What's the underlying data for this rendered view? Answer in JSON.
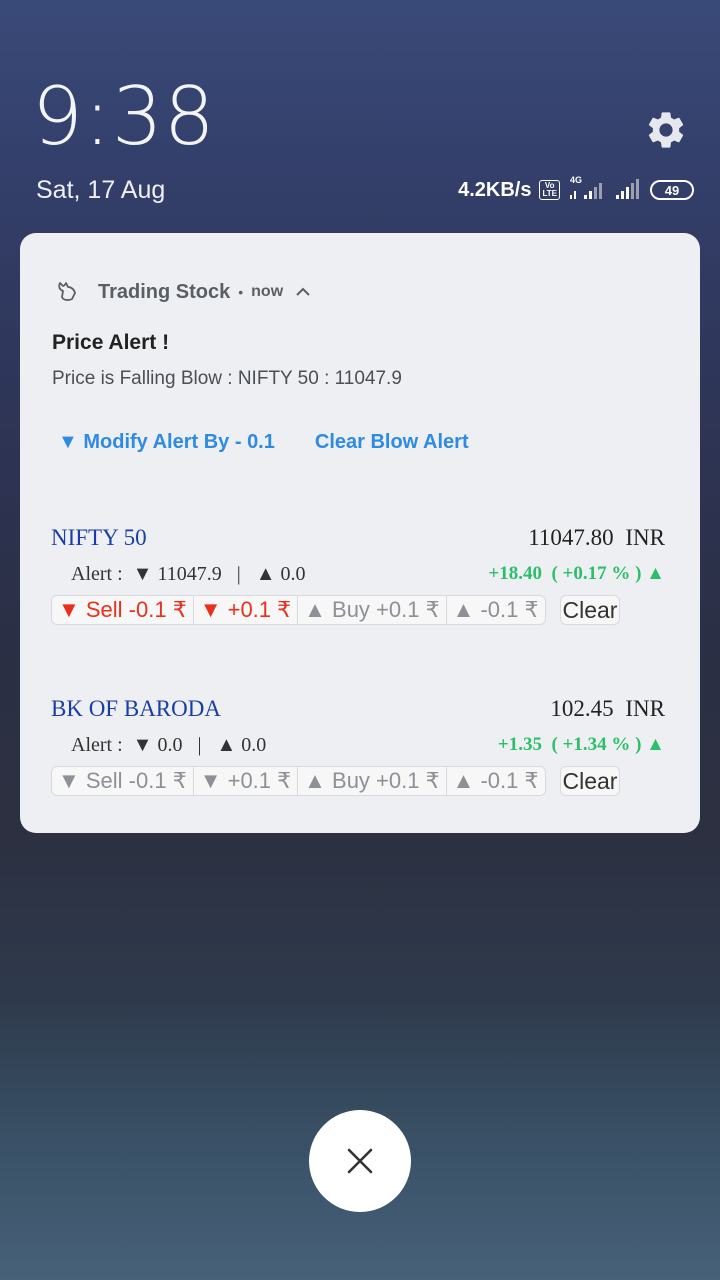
{
  "lockscreen": {
    "time": "9:38",
    "date": "Sat, 17 Aug"
  },
  "status": {
    "net_speed": "4.2KB/s",
    "volte_top": "Vo",
    "volte_bottom": "LTE",
    "network": "4G",
    "battery": "49"
  },
  "notification": {
    "app_name": "Trading Stock",
    "separator": "•",
    "when": "now",
    "title": "Price Alert !",
    "text": "Price is Falling Blow : NIFTY 50 : 11047.9",
    "actions": [
      "▼ Modify Alert By - 0.1",
      "Clear Blow Alert"
    ]
  },
  "stocks": [
    {
      "name": "NIFTY 50",
      "price": "11047.80 INR",
      "alert": "Alert :  ▼ 11047.9   |   ▲ 0.0",
      "change": "+18.40  ( +0.17 % ) ▲",
      "buttons": [
        "▼ Sell -0.1 ₹",
        "▼ +0.1 ₹",
        "▲ Buy +0.1 ₹",
        "▲ -0.1 ₹"
      ],
      "clear": "Clear"
    },
    {
      "name": "BK OF BARODA",
      "price": "102.45 INR",
      "alert": "Alert :  ▼ 0.0   |   ▲ 0.0",
      "change": "+1.35  ( +1.34 % ) ▲",
      "buttons": [
        "▼ Sell -0.1 ₹",
        "▼ +0.1 ₹",
        "▲ Buy +0.1 ₹",
        "▲ -0.1 ₹"
      ],
      "clear": "Clear"
    }
  ],
  "colors": {
    "accent_blue": "#2e8be4",
    "stock_name": "#1a3ea8",
    "sell_red": "#e8301c",
    "gain_green": "#2bbf6a"
  }
}
